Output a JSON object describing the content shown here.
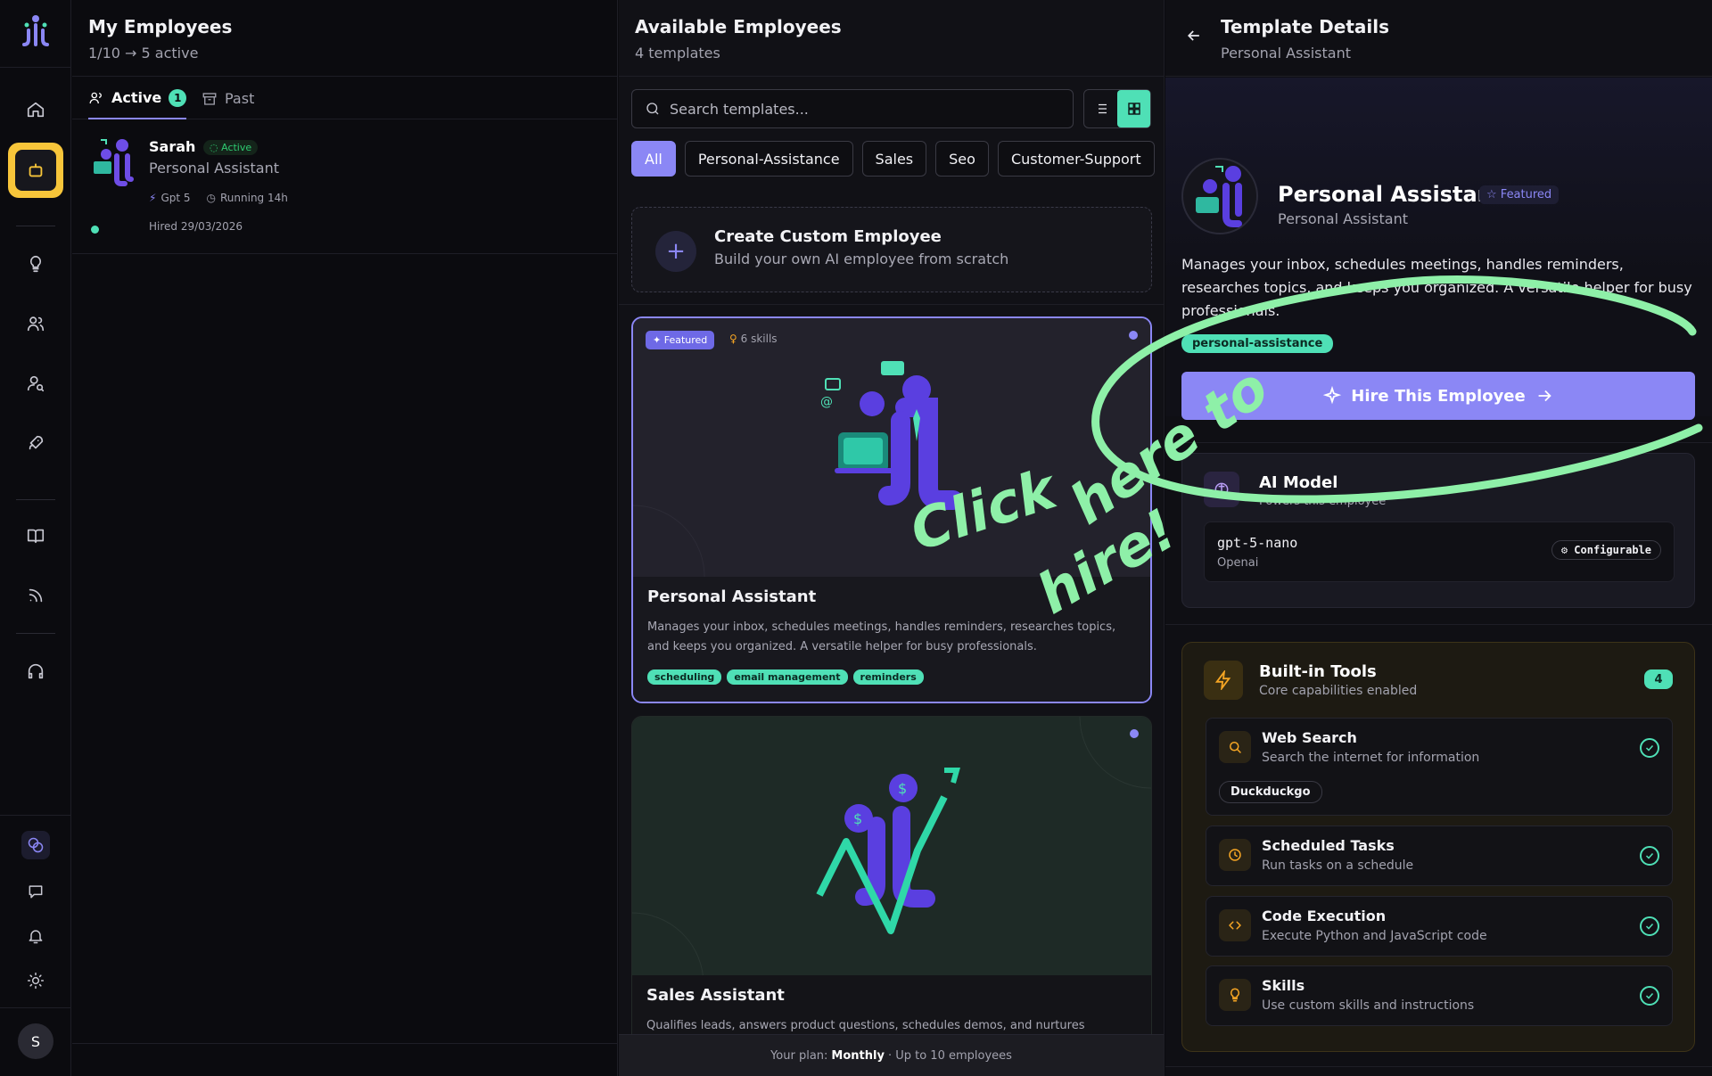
{
  "rail": {
    "nav_icons": [
      "home-icon",
      "bot-icon",
      "lightbulb-icon",
      "users-icon",
      "user-search-icon",
      "rocket-icon",
      "book-icon",
      "rss-icon",
      "headphones-icon"
    ],
    "bottom_icons": [
      "coins-icon",
      "message-icon",
      "bell-icon",
      "sun-icon"
    ],
    "avatar_initial": "S",
    "accent": "#f7c53a"
  },
  "my_employees": {
    "title": "My Employees",
    "subtitle": "1/10 → 5 active",
    "tabs": [
      {
        "label": "Active",
        "count": "1"
      },
      {
        "label": "Past"
      }
    ],
    "employees": [
      {
        "name": "Sarah",
        "status": "Active",
        "role": "Personal Assistant",
        "model": "Gpt 5",
        "running": "Running 14h",
        "hired": "Hired 29/03/2026"
      }
    ]
  },
  "available": {
    "title": "Available Employees",
    "subtitle": "4 templates",
    "search_placeholder": "Search templates...",
    "filters": [
      "All",
      "Personal-Assistance",
      "Sales",
      "Seo",
      "Customer-Support"
    ],
    "create": {
      "title": "Create Custom Employee",
      "subtitle": "Build your own AI employee from scratch"
    },
    "cards": [
      {
        "featured": "Featured",
        "skills": "6 skills",
        "title": "Personal Assistant",
        "desc": "Manages your inbox, schedules meetings, handles reminders, researches topics, and keeps you organized. A versatile helper for busy professionals.",
        "tags": [
          "scheduling",
          "email management",
          "reminders"
        ]
      },
      {
        "title": "Sales Assistant",
        "desc": "Qualifies leads, answers product questions, schedules demos, and nurtures"
      }
    ],
    "plan": {
      "prefix": "Your plan:",
      "name": "Monthly",
      "suffix": "· Up to 10 employees"
    }
  },
  "details": {
    "title": "Template Details",
    "subtitle": "Personal Assistant",
    "name": "Personal Assistant",
    "featured": "Featured",
    "role": "Personal Assistant",
    "description": "Manages your inbox, schedules meetings, handles reminders, researches topics, and keeps you organized. A versatile helper for busy professionals.",
    "tag": "personal-assistance",
    "hire_label": "Hire This Employee",
    "ai_model": {
      "title": "AI Model",
      "subtitle": "Powers this employee",
      "model": "gpt-5-nano",
      "provider": "Openai",
      "badge": "Configurable"
    },
    "tools": {
      "title": "Built-in Tools",
      "subtitle": "Core capabilities enabled",
      "count": "4",
      "items": [
        {
          "name": "Web Search",
          "desc": "Search the internet for information",
          "chip": "Duckduckgo",
          "icon": "search-icon"
        },
        {
          "name": "Scheduled Tasks",
          "desc": "Run tasks on a schedule",
          "icon": "clock-icon"
        },
        {
          "name": "Code Execution",
          "desc": "Execute Python and JavaScript code",
          "icon": "code-icon"
        },
        {
          "name": "Skills",
          "desc": "Use custom skills and instructions",
          "icon": "lightbulb-icon"
        }
      ]
    }
  },
  "annotation": {
    "line1": "Click",
    "line2": "here to",
    "line3": "hire!",
    "color": "#8ef0a8"
  }
}
